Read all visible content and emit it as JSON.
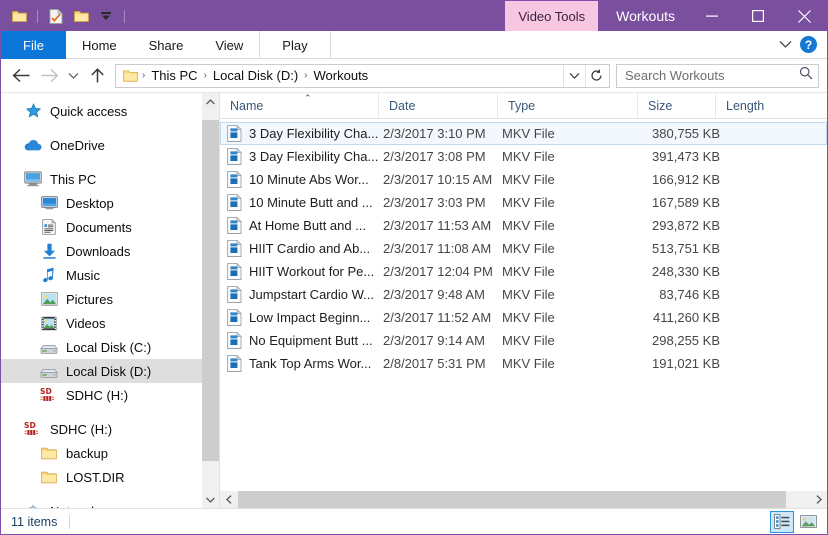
{
  "window": {
    "title": "Workouts",
    "contextual_tab": "Video Tools",
    "quick_access_icons": [
      "folder-icon",
      "properties-icon",
      "new-folder-icon",
      "customize-chevron-icon"
    ],
    "controls": {
      "minimize": "minimize-icon",
      "maximize": "maximize-icon",
      "close": "close-icon"
    },
    "accent_purple": "#7a4f9e",
    "contextual_pink": "#f7c6e0",
    "file_tab_blue": "#0c77d8"
  },
  "ribbon": {
    "tabs": [
      {
        "label": "File"
      },
      {
        "label": "Home"
      },
      {
        "label": "Share"
      },
      {
        "label": "View"
      },
      {
        "label": "Play"
      }
    ],
    "expand_label": "chevron-down-icon",
    "help_label": "?"
  },
  "address": {
    "back": "back-arrow-icon",
    "forward": "forward-arrow-icon",
    "recent": "recent-locations-chevron-icon",
    "up": "up-arrow-icon",
    "crumbs": [
      "This PC",
      "Local Disk (D:)",
      "Workouts"
    ],
    "separator": "›",
    "dropdown": "chevron-down-icon",
    "refresh": "refresh-icon"
  },
  "search": {
    "placeholder": "Search Workouts",
    "icon": "search-icon"
  },
  "sidebar": {
    "items": [
      {
        "label": "Quick access",
        "icon": "star-icon",
        "level": 0,
        "selected": false,
        "gap_before": false
      },
      {
        "label": "OneDrive",
        "icon": "cloud-icon",
        "level": 0,
        "selected": false,
        "gap_before": true
      },
      {
        "label": "This PC",
        "icon": "monitor-icon",
        "level": 0,
        "selected": false,
        "gap_before": true
      },
      {
        "label": "Desktop",
        "icon": "desktop-icon",
        "level": 1,
        "selected": false,
        "gap_before": false
      },
      {
        "label": "Documents",
        "icon": "documents-icon",
        "level": 1,
        "selected": false,
        "gap_before": false
      },
      {
        "label": "Downloads",
        "icon": "downloads-icon",
        "level": 1,
        "selected": false,
        "gap_before": false
      },
      {
        "label": "Music",
        "icon": "music-icon",
        "level": 1,
        "selected": false,
        "gap_before": false
      },
      {
        "label": "Pictures",
        "icon": "pictures-icon",
        "level": 1,
        "selected": false,
        "gap_before": false
      },
      {
        "label": "Videos",
        "icon": "videos-icon",
        "level": 1,
        "selected": false,
        "gap_before": false
      },
      {
        "label": "Local Disk (C:)",
        "icon": "drive-icon",
        "level": 1,
        "selected": false,
        "gap_before": false
      },
      {
        "label": "Local Disk (D:)",
        "icon": "drive-icon",
        "level": 1,
        "selected": true,
        "gap_before": false
      },
      {
        "label": "SDHC (H:)",
        "icon": "sd-card-icon",
        "level": 1,
        "selected": false,
        "gap_before": false
      },
      {
        "label": "SDHC (H:)",
        "icon": "sd-card-icon",
        "level": 0,
        "selected": false,
        "gap_before": true
      },
      {
        "label": "backup",
        "icon": "folder-icon",
        "level": 1,
        "selected": false,
        "gap_before": false
      },
      {
        "label": "LOST.DIR",
        "icon": "folder-icon",
        "level": 1,
        "selected": false,
        "gap_before": false
      },
      {
        "label": "Network",
        "icon": "network-icon",
        "level": 0,
        "selected": false,
        "gap_before": true
      }
    ]
  },
  "filelist": {
    "columns": [
      {
        "label": "Name",
        "sorted": "asc"
      },
      {
        "label": "Date",
        "sorted": ""
      },
      {
        "label": "Type",
        "sorted": ""
      },
      {
        "label": "Size",
        "sorted": ""
      },
      {
        "label": "Length",
        "sorted": ""
      }
    ],
    "sort_caret": "⌃",
    "rows": [
      {
        "name": "3 Day Flexibility Cha...",
        "date": "2/3/2017 3:10 PM",
        "type": "MKV File",
        "size": "380,755 KB",
        "length": "",
        "selected": true
      },
      {
        "name": "3 Day Flexibility Cha...",
        "date": "2/3/2017 3:08 PM",
        "type": "MKV File",
        "size": "391,473 KB",
        "length": "",
        "selected": false
      },
      {
        "name": "10 Minute Abs Wor...",
        "date": "2/3/2017 10:15 AM",
        "type": "MKV File",
        "size": "166,912 KB",
        "length": "",
        "selected": false
      },
      {
        "name": "10 Minute Butt and ...",
        "date": "2/3/2017 3:03 PM",
        "type": "MKV File",
        "size": "167,589 KB",
        "length": "",
        "selected": false
      },
      {
        "name": "At Home Butt and ...",
        "date": "2/3/2017 11:53 AM",
        "type": "MKV File",
        "size": "293,872 KB",
        "length": "",
        "selected": false
      },
      {
        "name": "HIIT Cardio and Ab...",
        "date": "2/3/2017 11:08 AM",
        "type": "MKV File",
        "size": "513,751 KB",
        "length": "",
        "selected": false
      },
      {
        "name": "HIIT Workout for Pe...",
        "date": "2/3/2017 12:04 PM",
        "type": "MKV File",
        "size": "248,330 KB",
        "length": "",
        "selected": false
      },
      {
        "name": "Jumpstart Cardio W...",
        "date": "2/3/2017 9:48 AM",
        "type": "MKV File",
        "size": "83,746 KB",
        "length": "",
        "selected": false
      },
      {
        "name": "Low Impact Beginn...",
        "date": "2/3/2017 11:52 AM",
        "type": "MKV File",
        "size": "411,260 KB",
        "length": "",
        "selected": false
      },
      {
        "name": "No Equipment Butt ...",
        "date": "2/3/2017 9:14 AM",
        "type": "MKV File",
        "size": "298,255 KB",
        "length": "",
        "selected": false
      },
      {
        "name": "Tank Top Arms Wor...",
        "date": "2/8/2017 5:31 PM",
        "type": "MKV File",
        "size": "191,021 KB",
        "length": "",
        "selected": false
      }
    ]
  },
  "statusbar": {
    "item_count": "11 items",
    "views": [
      {
        "name": "details-view",
        "active": true
      },
      {
        "name": "large-icons-view",
        "active": false
      }
    ]
  }
}
